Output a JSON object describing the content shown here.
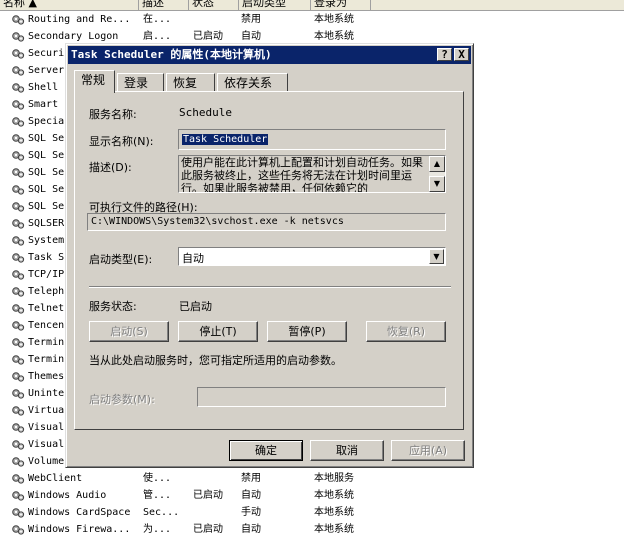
{
  "list_header": {
    "columns": [
      "名称 ▲",
      "描述",
      "状态",
      "启动类型",
      "登录为"
    ]
  },
  "services": [
    {
      "name": "Routing and Re...",
      "desc": "在...",
      "status": "",
      "type": "禁用",
      "logon": "本地系统"
    },
    {
      "name": "Secondary Logon",
      "desc": "启...",
      "status": "已启动",
      "type": "自动",
      "logon": "本地系统"
    },
    {
      "name": "Securi",
      "desc": "",
      "status": "",
      "type": "",
      "logon": ""
    },
    {
      "name": "Server",
      "desc": "",
      "status": "",
      "type": "",
      "logon": ""
    },
    {
      "name": "Shell",
      "desc": "",
      "status": "",
      "type": "",
      "logon": ""
    },
    {
      "name": "Smart",
      "desc": "",
      "status": "",
      "type": "",
      "logon": ""
    },
    {
      "name": "Specia",
      "desc": "",
      "status": "",
      "type": "",
      "logon": ""
    },
    {
      "name": "SQL Se",
      "desc": "",
      "status": "",
      "type": "",
      "logon": ""
    },
    {
      "name": "SQL Se",
      "desc": "",
      "status": "",
      "type": "",
      "logon": ""
    },
    {
      "name": "SQL Se",
      "desc": "",
      "status": "",
      "type": "",
      "logon": ""
    },
    {
      "name": "SQL Se",
      "desc": "",
      "status": "",
      "type": "",
      "logon": ""
    },
    {
      "name": "SQL Se",
      "desc": "",
      "status": "",
      "type": "",
      "logon": ""
    },
    {
      "name": "SQLSER",
      "desc": "",
      "status": "",
      "type": "",
      "logon": ""
    },
    {
      "name": "System",
      "desc": "",
      "status": "",
      "type": "",
      "logon": ""
    },
    {
      "name": "Task S",
      "desc": "",
      "status": "",
      "type": "",
      "logon": ""
    },
    {
      "name": "TCP/IP",
      "desc": "",
      "status": "",
      "type": "",
      "logon": ""
    },
    {
      "name": "Teleph",
      "desc": "",
      "status": "",
      "type": "",
      "logon": ""
    },
    {
      "name": "Telnet",
      "desc": "",
      "status": "",
      "type": "",
      "logon": ""
    },
    {
      "name": "Tencen",
      "desc": "",
      "status": "",
      "type": "",
      "logon": ""
    },
    {
      "name": "Termin",
      "desc": "",
      "status": "",
      "type": "",
      "logon": ""
    },
    {
      "name": "Termin",
      "desc": "",
      "status": "",
      "type": "",
      "logon": ""
    },
    {
      "name": "Themes",
      "desc": "",
      "status": "",
      "type": "",
      "logon": ""
    },
    {
      "name": "Uninte",
      "desc": "",
      "status": "",
      "type": "",
      "logon": ""
    },
    {
      "name": "Virtua",
      "desc": "",
      "status": "",
      "type": "",
      "logon": ""
    },
    {
      "name": "Visual",
      "desc": "",
      "status": "",
      "type": "",
      "logon": ""
    },
    {
      "name": "Visual",
      "desc": "",
      "status": "",
      "type": "",
      "logon": ""
    },
    {
      "name": "Volume",
      "desc": "",
      "status": "",
      "type": "",
      "logon": ""
    },
    {
      "name": "WebClient",
      "desc": "使...",
      "status": "",
      "type": "禁用",
      "logon": "本地服务"
    },
    {
      "name": "Windows Audio",
      "desc": "管...",
      "status": "已启动",
      "type": "自动",
      "logon": "本地系统"
    },
    {
      "name": "Windows CardSpace",
      "desc": "Sec...",
      "status": "",
      "type": "手动",
      "logon": "本地系统"
    },
    {
      "name": "Windows Firewa...",
      "desc": "为...",
      "status": "已启动",
      "type": "自动",
      "logon": "本地系统"
    }
  ],
  "dialog": {
    "title": "Task Scheduler 的属性(本地计算机)",
    "help_btn": "?",
    "close_btn": "X",
    "tabs": [
      "常规",
      "登录",
      "恢复",
      "依存关系"
    ],
    "service_name_label": "服务名称:",
    "service_name": "Schedule",
    "display_name_label": "显示名称(N):",
    "display_name": "Task Scheduler",
    "description_label": "描述(D):",
    "description": "使用户能在此计算机上配置和计划自动任务。如果此服务被终止，这些任务将无法在计划时间里运行。如果此服务被禁用，任何依赖它的",
    "exe_path_label": "可执行文件的路径(H):",
    "exe_path": "C:\\WINDOWS\\System32\\svchost.exe -k netsvcs",
    "startup_type_label": "启动类型(E):",
    "startup_type": "自动",
    "status_label": "服务状态:",
    "status_value": "已启动",
    "btn_start": "启动(S)",
    "btn_stop": "停止(T)",
    "btn_pause": "暂停(P)",
    "btn_resume": "恢复(R)",
    "hint": "当从此处启动服务时，您可指定所适用的启动参数。",
    "params_label": "启动参数(M):",
    "params_value": "",
    "btn_ok": "确定",
    "btn_cancel": "取消",
    "btn_apply": "应用(A)"
  }
}
